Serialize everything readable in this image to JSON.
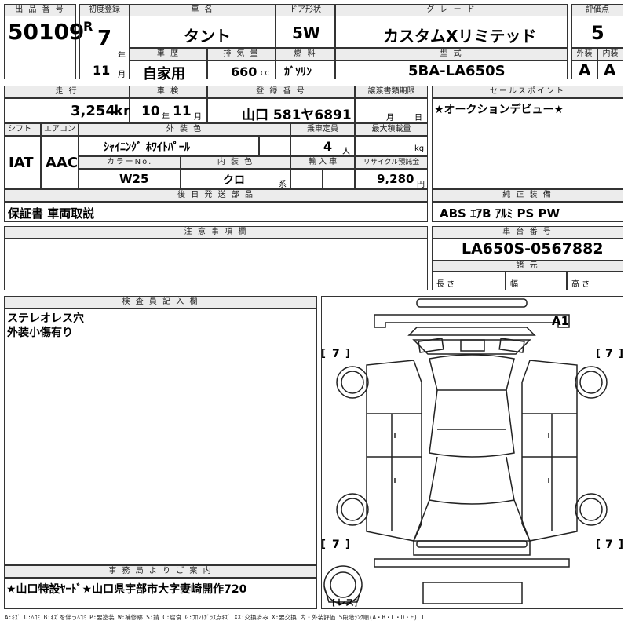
{
  "header": {
    "lot_number_label": "出 品 番 号",
    "lot_number": "50109",
    "first_reg_label": "初度登録",
    "era_prefix": "R",
    "year_value": "7",
    "year_unit": "年",
    "month_value": "11",
    "month_unit": "月",
    "car_name_label": "車 名",
    "car_name": "タント",
    "door_label": "ドア形状",
    "door": "5W",
    "grade_label": "グ レ ー ド",
    "grade": "カスタムXリミテッド",
    "score_label": "評価点",
    "score": "5",
    "history_label": "車 歴",
    "history": "自家用",
    "displacement_label": "排 気 量",
    "displacement": "660",
    "displacement_unit": "CC",
    "fuel_label": "燃 料",
    "fuel": "ｶﾞｿﾘﾝ",
    "model_label": "型 式",
    "model": "5BA-LA650S",
    "exterior_label": "外装",
    "exterior_grade": "A",
    "interior_label": "内装",
    "interior_grade": "A"
  },
  "row2": {
    "mileage_label": "走 行",
    "mileage": "3,254",
    "mileage_unit": "km",
    "inspection_label": "車 検",
    "inspection_year": "10",
    "inspection_year_unit": "年",
    "inspection_month": "11",
    "inspection_month_unit": "月",
    "registration_label": "登 録 番 号",
    "registration": "山口  581ヤ6891",
    "transfer_label": "譲渡書類期限",
    "transfer_month_unit": "月",
    "transfer_day_unit": "日",
    "sales_point_label": "セールスポイント",
    "sales_point": "★オークションデビュー★"
  },
  "row3": {
    "shift_label": "シフト",
    "shift": "IAT",
    "aircon_label": "エアコン",
    "aircon": "AAC",
    "color_label": "外 装 色",
    "color": "ｼｬｲﾆﾝｸﾞ ﾎﾜｲﾄﾊﾟｰﾙ",
    "capacity_label": "乗車定員",
    "capacity": "4",
    "capacity_unit": "人",
    "load_label": "最大積載量",
    "load_unit": "kg",
    "color_no_label": "カラーNo.",
    "color_no": "W25",
    "interior_color_label": "内 装 色",
    "interior_color": "クロ",
    "interior_color_unit": "系",
    "import_label": "輸 入 車",
    "recycle_label": "リサイクル預託金",
    "recycle": "9,280",
    "recycle_unit": "円"
  },
  "later": {
    "label": "後 日 発 送 部 品",
    "content": "保証書 車両取説"
  },
  "equipment": {
    "label": "純 正 装 備",
    "content": "ABS ｴｱB ｱﾙﾐ PS PW"
  },
  "notes": {
    "label": "注 意 事 項 欄"
  },
  "chassis": {
    "label": "車 台 番 号",
    "number": "LA650S-0567882",
    "dims_label": "諸 元",
    "length_label": "長 さ",
    "width_label": "幅",
    "height_label": "高 さ"
  },
  "inspector": {
    "label": "検 査 員 記 入 欄",
    "line1": "ステレオレス穴",
    "line2": "外装小傷有り"
  },
  "diagram": {
    "marks": {
      "hood": "A1",
      "front_left": "7",
      "front_right": "7",
      "rear_left": "7",
      "rear_right": "7"
    },
    "spare": "レス"
  },
  "office": {
    "label": "事 務 局 よ り ご 案 内",
    "content": "★山口特設ﾔｰﾄﾞ★山口県宇部市大字妻崎開作720"
  },
  "legend": "A:ｷｽﾞ U:ﾍｺﾐ B:ｷｽﾞを伴うﾍｺﾐ P:要塗装 W:補修跡 S:錆 C:腐食 G:ﾌﾛﾝﾄｶﾞﾗｽ点ｷｽﾞ XX:交換済み X:要交換  内・外装評価 5段階ﾗﾝｸ順(A・B・C・D・E) 1"
}
